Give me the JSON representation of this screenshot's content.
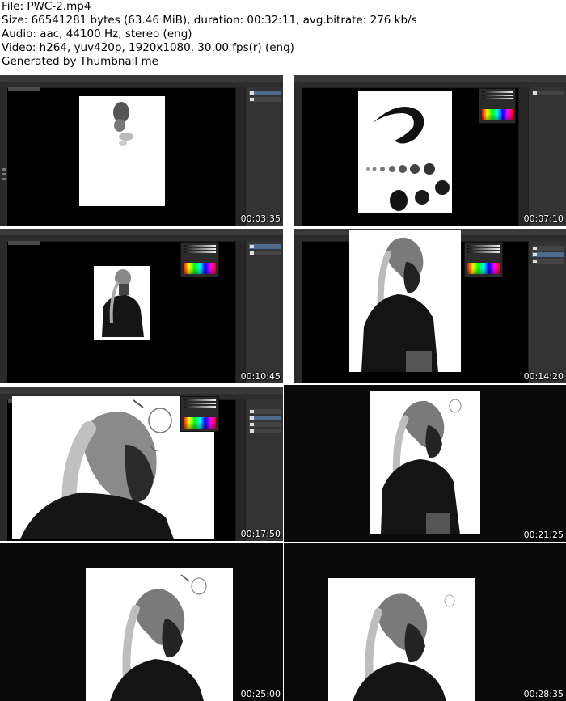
{
  "header": {
    "file_line": "File: PWC-2.mp4",
    "size_line": "Size: 66541281 bytes (63.46 MiB), duration: 00:32:11, avg.bitrate: 276 kb/s",
    "audio_line": "Audio: aac, 44100 Hz, stereo (eng)",
    "video_line": "Video: h264, yuv420p, 1920x1080, 30.00 fps(r) (eng)",
    "generated_line": "Generated by Thumbnail me"
  },
  "thumbnails": [
    {
      "timestamp": "00:03:35",
      "content": "photoshop-canvas-sketch-start"
    },
    {
      "timestamp": "00:07:10",
      "content": "photoshop-brush-test-strokes"
    },
    {
      "timestamp": "00:10:45",
      "content": "photoshop-figure-blockin"
    },
    {
      "timestamp": "00:14:20",
      "content": "photoshop-figure-refine"
    },
    {
      "timestamp": "00:17:50",
      "content": "photoshop-head-closeup"
    },
    {
      "timestamp": "00:21:25",
      "content": "figure-fullscreen"
    },
    {
      "timestamp": "00:25:00",
      "content": "figure-fullscreen"
    },
    {
      "timestamp": "00:28:35",
      "content": "figure-fullscreen-final"
    }
  ]
}
